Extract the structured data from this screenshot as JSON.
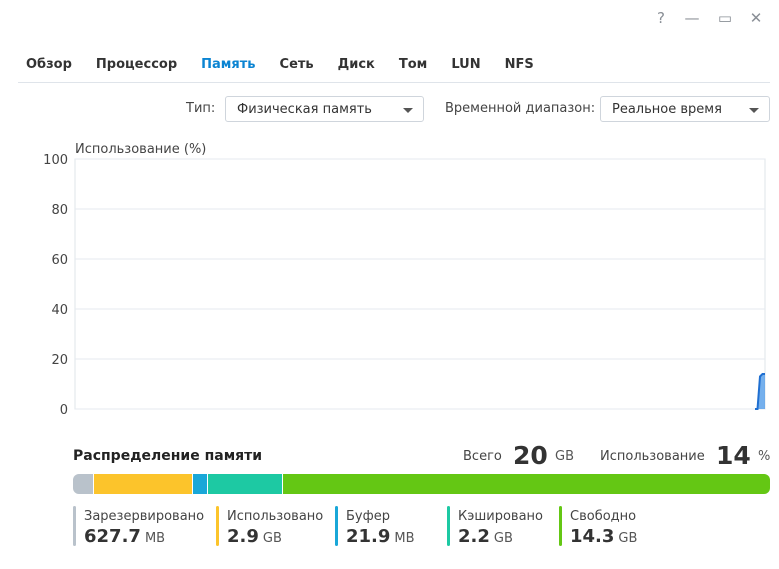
{
  "window": {
    "controls": [
      {
        "name": "help-icon",
        "glyph": "?"
      },
      {
        "name": "minimize-icon",
        "glyph": "—"
      },
      {
        "name": "maximize-icon",
        "glyph": "▭"
      },
      {
        "name": "close-icon",
        "glyph": "✕"
      }
    ]
  },
  "tabs": [
    {
      "label": "Обзор",
      "active": false
    },
    {
      "label": "Процессор",
      "active": false
    },
    {
      "label": "Память",
      "active": true
    },
    {
      "label": "Сеть",
      "active": false
    },
    {
      "label": "Диск",
      "active": false
    },
    {
      "label": "Том",
      "active": false
    },
    {
      "label": "LUN",
      "active": false
    },
    {
      "label": "NFS",
      "active": false
    }
  ],
  "filters": {
    "type_label": "Тип:",
    "type_value": "Физическая память",
    "range_label": "Временной диапазон:",
    "range_value": "Реальное время"
  },
  "chart_data": {
    "type": "area",
    "ylabel": "Использование (%)",
    "ylim": [
      0,
      100
    ],
    "yticks": [
      100,
      80,
      60,
      40,
      20,
      0
    ],
    "grid": true,
    "series": [
      {
        "values": [
          0,
          0,
          13,
          14,
          14
        ],
        "color": "#3a8ee6"
      }
    ]
  },
  "memory": {
    "title": "Распределение памяти",
    "total_label": "Всего",
    "total_value": "20",
    "total_unit": "GB",
    "usage_label": "Использование",
    "usage_value": "14",
    "usage_unit": "%",
    "segments": [
      {
        "label": "Зарезервировано",
        "value": "627.7",
        "unit": "MB",
        "color": "#b9c2cb"
      },
      {
        "label": "Использовано",
        "value": "2.9",
        "unit": "GB",
        "color": "#fcc42b"
      },
      {
        "label": "Буфер",
        "value": "21.9",
        "unit": "MB",
        "color": "#19a7d8"
      },
      {
        "label": "Кэшировано",
        "value": "2.2",
        "unit": "GB",
        "color": "#1dc9a3"
      },
      {
        "label": "Свободно",
        "value": "14.3",
        "unit": "GB",
        "color": "#64c714"
      }
    ]
  }
}
